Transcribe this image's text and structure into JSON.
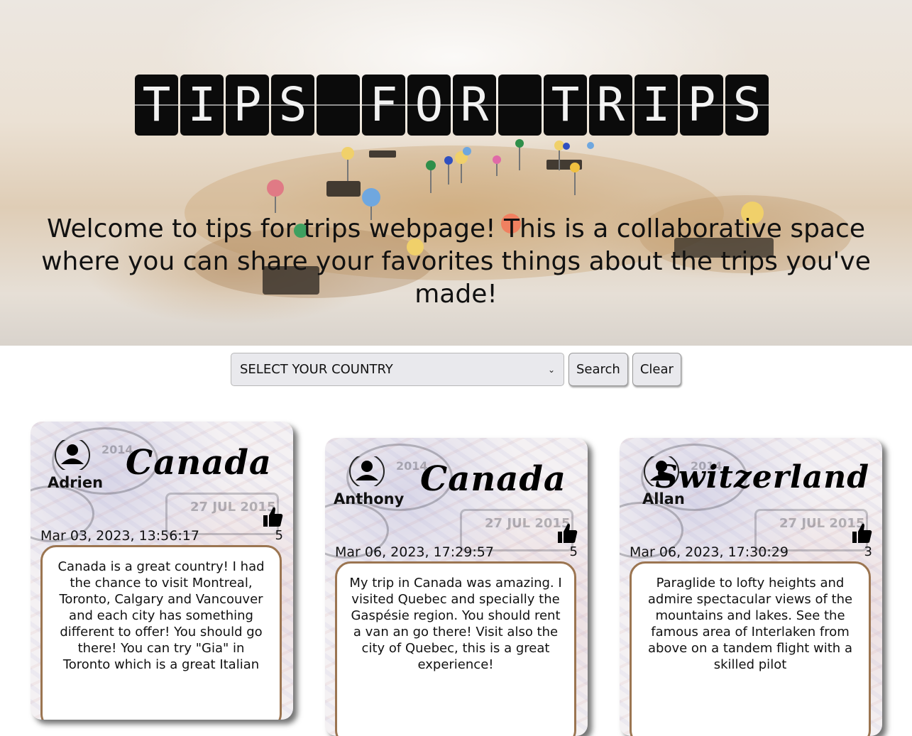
{
  "hero": {
    "title_letters": [
      "T",
      "I",
      "P",
      "S",
      " ",
      "F",
      "O",
      "R",
      " ",
      "T",
      "R",
      "I",
      "P",
      "S"
    ],
    "welcome_text": "Welcome to tips for trips webpage! This is a collaborative space where you can share your favorites things about the trips you've made!"
  },
  "search": {
    "select_value": "SELECT YOUR COUNTRY",
    "search_label": "Search",
    "clear_label": "Clear"
  },
  "cards": [
    {
      "user": "Adrien",
      "country": "Canada",
      "date": "Mar 03, 2023, 13:56:17",
      "likes": "5",
      "text": "Canada is a great country! I had the chance to visit Montreal, Toronto, Calgary and Vancouver and each city has something different to offer! You should go there! You can try \"Gia\" in Toronto which is a great Italian"
    },
    {
      "user": "Anthony",
      "country": "Canada",
      "date": "Mar 06, 2023, 17:29:57",
      "likes": "5",
      "text": "My trip in Canada was amazing. I visited Quebec and specially the Gaspésie region. You should rent a van an go there! Visit also the city of Quebec, this is a great experience!"
    },
    {
      "user": "Allan",
      "country": "Switzerland",
      "date": "Mar 06, 2023, 17:30:29",
      "likes": "3",
      "text": "Paraglide to lofty heights and admire spectacular views of the mountains and lakes. See the famous area of Interlaken from above on a tandem flight with a skilled pilot"
    }
  ],
  "icons": {
    "avatar": "user-avatar-icon",
    "like": "thumbs-up-icon",
    "select": "chevron-down-icon"
  }
}
